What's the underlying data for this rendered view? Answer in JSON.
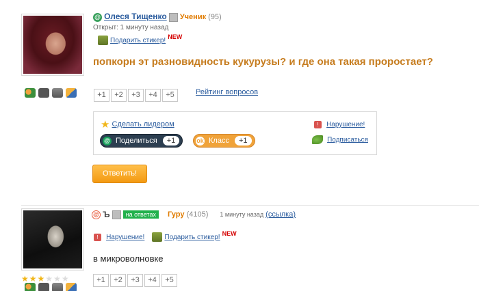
{
  "question": {
    "author": "Олеся Тищенко",
    "rank": "Ученик",
    "rank_points": "(95)",
    "opened": "Открыт: 1 минуту назад",
    "gift_sticker": "Подарить стикер!",
    "new_badge": "NEW",
    "text": "попкорн эт разновидность кукурузы? и где она такая проростает?",
    "votes": [
      "+1",
      "+2",
      "+3",
      "+4",
      "+5"
    ],
    "rating_link": "Рейтинг вопросов",
    "make_leader": "Сделать лидером",
    "share_label": "Поделиться",
    "share_count": "+1",
    "class_label": "Класс",
    "class_count": "+1",
    "violation": "Нарушение!",
    "subscribe": "Подписаться",
    "answer_button": "Ответить!"
  },
  "answer": {
    "guru_badge": "на ответах",
    "rank": "Гуру",
    "rank_points": "(4105)",
    "time": "1 минуту назад",
    "link": "(ссылка)",
    "violation": "Нарушение!",
    "gift_sticker": "Подарить стикер!",
    "new_badge": "NEW",
    "text": "в микроволновке",
    "votes": [
      "+1",
      "+2",
      "+3",
      "+4",
      "+5"
    ],
    "stars_filled": 3,
    "stars_total": 6
  },
  "icons": {
    "friends": "friends-icon",
    "photo": "camera-icon",
    "video": "video-icon",
    "edit": "edit-icon"
  },
  "colors": {
    "question_text": "#c67c1e",
    "link": "#2b5c9e",
    "rank": "#e07b00",
    "answer_button": "#f39a12",
    "guru_badge": "#22b14c"
  }
}
